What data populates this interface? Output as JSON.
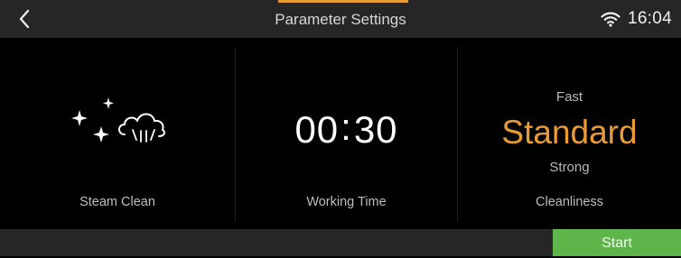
{
  "header": {
    "title": "Parameter Settings",
    "back_icon": "chevron-left-icon",
    "wifi_icon": "wifi-icon",
    "time": "16:04",
    "accent_color": "#e99c35"
  },
  "panels": {
    "mode": {
      "icon": "steam-clean-icon",
      "label": "Steam Clean"
    },
    "working_time": {
      "minutes": "00",
      "separator": ":",
      "seconds": "30",
      "label": "Working Time"
    },
    "cleanliness": {
      "options": [
        "Fast",
        "Standard",
        "Strong"
      ],
      "selected": "Standard",
      "label": "Cleanliness",
      "selected_color": "#e99c35"
    }
  },
  "footer": {
    "start_label": "Start",
    "start_color": "#5fb549"
  }
}
